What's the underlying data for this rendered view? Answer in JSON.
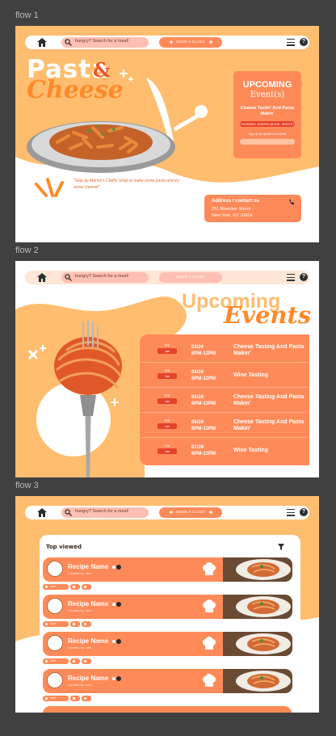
{
  "flows": [
    "flow 1",
    "flow 2",
    "flow 3"
  ],
  "nav": {
    "search_placeholder": "hungry? Search for a meal!",
    "book_label": "BOOK A CLASS",
    "help": "?"
  },
  "flow1": {
    "title_line1": "Pasta",
    "title_amp": "&",
    "title_line2": "Cheese",
    "quote": "\"Stop by Manny's Cheffy Shop to make some pasta and try some cheese!\"",
    "events_card": {
      "heading": "UPCOMING",
      "subheading": "Event(s)",
      "event_name": "Cheese Tastin' And Pasta Makin'",
      "event_date": "THURSDAY, 3/29/2024 @ 6:00 - 8PM EST",
      "signup_text": "Sign up for updates on events",
      "email_placeholder": "email@..."
    },
    "address": {
      "title": "Address / contact us",
      "line1": "251 Bleecker Street",
      "line2": "New York, NY 10014"
    }
  },
  "flow2": {
    "title_top": "Upcoming",
    "title_bottom": "Events",
    "events": [
      {
        "weekday": "FRI",
        "month": "Jan",
        "date": "03/24",
        "time": "6PM-12PM",
        "name": "Cheese Tasting And Pasta Makin'"
      },
      {
        "weekday": "FRI",
        "month": "Jan",
        "date": "04/24",
        "time": "6PM-12PM",
        "name": "Wine Tasting"
      },
      {
        "weekday": "FRI",
        "month": "Jan",
        "date": "05/24",
        "time": "6PM-12PM",
        "name": "Cheese Tasting And Pasta Makin'"
      },
      {
        "weekday": "FRI",
        "month": "Jan",
        "date": "06/24",
        "time": "6PM-12PM",
        "name": "Cheese Tasting And Pasta Makin'"
      },
      {
        "weekday": "Fall",
        "month": "Jan",
        "date": "07/24",
        "time": "6PM-12PM",
        "name": "Wine Tasting"
      }
    ]
  },
  "flow3": {
    "section_title": "Top viewed",
    "recipes": [
      {
        "name": "Recipe Name",
        "by": "Created by: user",
        "chip": "save"
      },
      {
        "name": "Recipe Name",
        "by": "Created by: user",
        "chip": "save"
      },
      {
        "name": "Recipe Name",
        "by": "Created by: user",
        "chip": "save"
      },
      {
        "name": "Recipe Name",
        "by": "Created by: user",
        "chip": "save"
      }
    ]
  },
  "colors": {
    "peach": "#ffbd6f",
    "orange": "#ff8a59",
    "red": "#e5422a",
    "canvas": "#404040"
  }
}
